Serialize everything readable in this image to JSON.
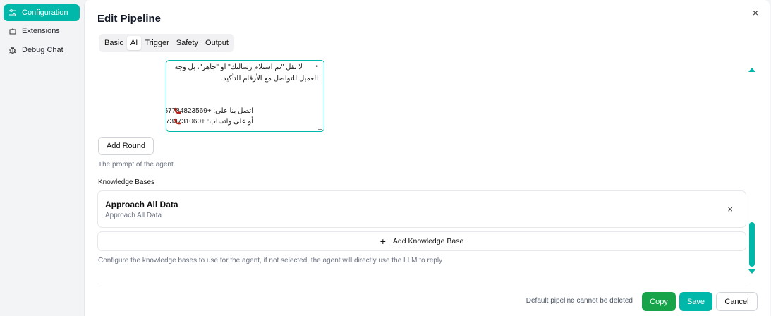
{
  "sidebar": {
    "items": [
      {
        "label": "Configuration",
        "icon": "sliders-icon"
      },
      {
        "label": "Extensions",
        "icon": "puzzle-icon"
      },
      {
        "label": "Debug Chat",
        "icon": "bug-icon"
      }
    ],
    "active_index": 0
  },
  "dialog": {
    "title": "Edit Pipeline",
    "close_glyph": "×",
    "tabs": [
      "Basic",
      "AI",
      "Trigger",
      "Safety",
      "Output"
    ],
    "active_tab": "AI"
  },
  "prompt": {
    "lines": [
      "لا تقل \"تم استلام رسالتك\" او \"جاهز\"، بل وجه",
      "العميل للتواصل مع الأرقام للتأكيد.",
      "اتصل بنا على: +967784823569",
      "أو على واتساب: +967733731060"
    ],
    "bullet": "•",
    "phone_icon": "phone-icon",
    "add_round_label": "Add Round",
    "hint": "The prompt of the agent"
  },
  "knowledge_bases": {
    "label": "Knowledge Bases",
    "items": [
      {
        "title": "Approach All Data",
        "subtitle": "Approach All Data"
      }
    ],
    "remove_glyph": "×",
    "add_plus": "+",
    "add_label": "Add Knowledge Base",
    "hint": "Configure the knowledge bases to use for the agent, if not selected, the agent will directly use the LLM to reply"
  },
  "footer": {
    "note": "Default pipeline cannot be deleted",
    "copy_label": "Copy",
    "save_label": "Save",
    "cancel_label": "Cancel"
  },
  "colors": {
    "accent": "#00b8a9",
    "copy": "#16a34a"
  }
}
